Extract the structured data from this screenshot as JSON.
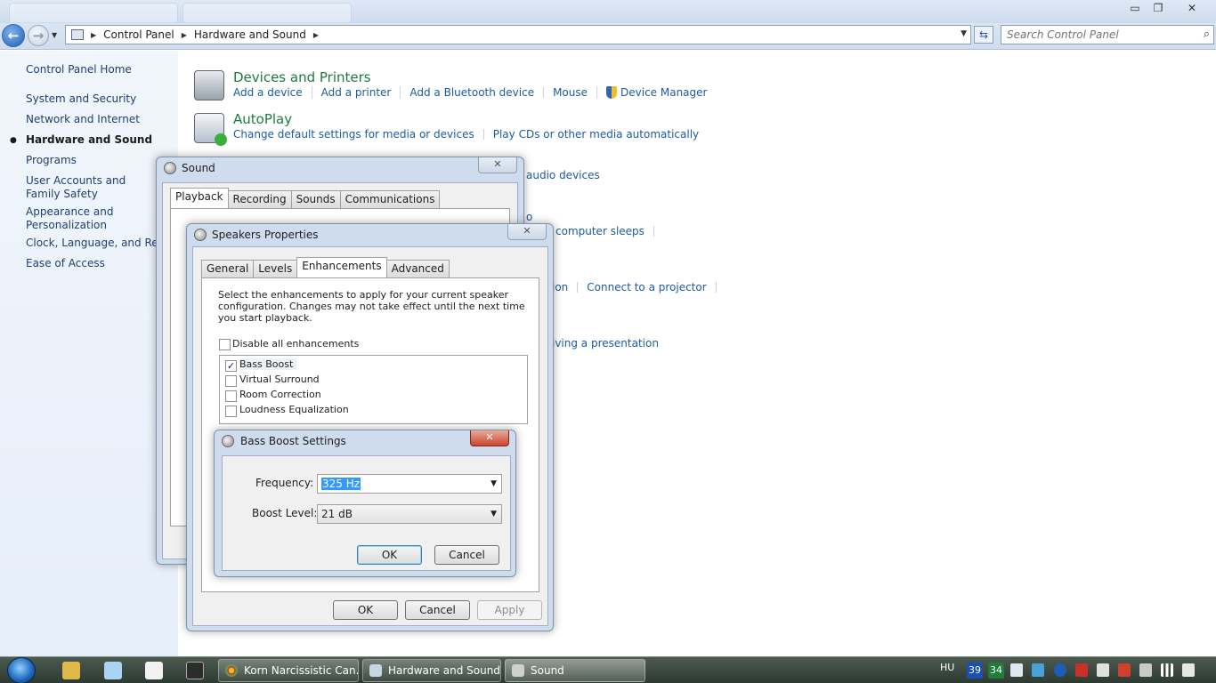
{
  "window": {
    "controls": {
      "minimize": "▭",
      "restore": "❐",
      "close": "✕"
    }
  },
  "address": {
    "crumbs": [
      "Control Panel",
      "Hardware and Sound"
    ],
    "search_placeholder": "Search Control Panel"
  },
  "sidebar": {
    "home": "Control Panel Home",
    "items": [
      {
        "label": "System and Security"
      },
      {
        "label": "Network and Internet"
      },
      {
        "label": "Hardware and Sound",
        "active": true
      },
      {
        "label": "Programs"
      },
      {
        "label": "User Accounts and Family Safety"
      },
      {
        "label": "Appearance and Personalization"
      },
      {
        "label": "Clock, Language, and Region"
      },
      {
        "label": "Ease of Access"
      }
    ]
  },
  "categories": [
    {
      "title": "Devices and Printers",
      "icon": "printer-icon",
      "links": [
        "Add a device",
        "Add a printer",
        "Add a Bluetooth device",
        "Mouse",
        "Device Manager"
      ]
    },
    {
      "title": "AutoPlay",
      "icon": "autoplay-icon",
      "links": [
        "Change default settings for media or devices",
        "Play CDs or other media automatically"
      ]
    }
  ],
  "partially_visible_links": {
    "sound_manage": "audio devices",
    "power_sleep": "computer sleeps",
    "display_proj_partial": "ion",
    "display_projector": "Connect to a projector",
    "mobility_partial": "iving a presentation",
    "power_partial": "o"
  },
  "sound_dialog": {
    "title": "Sound",
    "close": "✕",
    "tabs": [
      "Playback",
      "Recording",
      "Sounds",
      "Communications"
    ],
    "active_tab": "Playback"
  },
  "speakers_dialog": {
    "title": "Speakers Properties",
    "close": "✕",
    "tabs": [
      "General",
      "Levels",
      "Enhancements",
      "Advanced"
    ],
    "active_tab": "Enhancements",
    "description": "Select the enhancements to apply for your current speaker configuration. Changes may not take effect until the next time you start playback.",
    "disable_all": {
      "label": "Disable all enhancements",
      "checked": false
    },
    "enhancements": [
      {
        "label": "Bass Boost",
        "checked": true
      },
      {
        "label": "Virtual Surround",
        "checked": false
      },
      {
        "label": "Room Correction",
        "checked": false
      },
      {
        "label": "Loudness Equalization",
        "checked": false
      }
    ],
    "buttons": {
      "ok": "OK",
      "cancel": "Cancel",
      "apply": "Apply"
    }
  },
  "bass_dialog": {
    "title": "Bass Boost Settings",
    "close": "✕",
    "frequency_label": "Frequency:",
    "frequency_value": "325 Hz",
    "boost_label": "Boost Level:",
    "boost_value": "21 dB",
    "buttons": {
      "ok": "OK",
      "cancel": "Cancel"
    }
  },
  "taskbar": {
    "buttons": [
      {
        "label": "Korn Narcissistic Can..."
      },
      {
        "label": "Hardware and Sound"
      },
      {
        "label": "Sound"
      }
    ],
    "tray": {
      "lang": "HU",
      "badge1": "39",
      "badge2": "34"
    }
  },
  "colors": {
    "link": "#1e5aa0",
    "category_title": "#1e7a3c",
    "sidebar_link": "#1e3f72",
    "selection": "#3399ff"
  }
}
